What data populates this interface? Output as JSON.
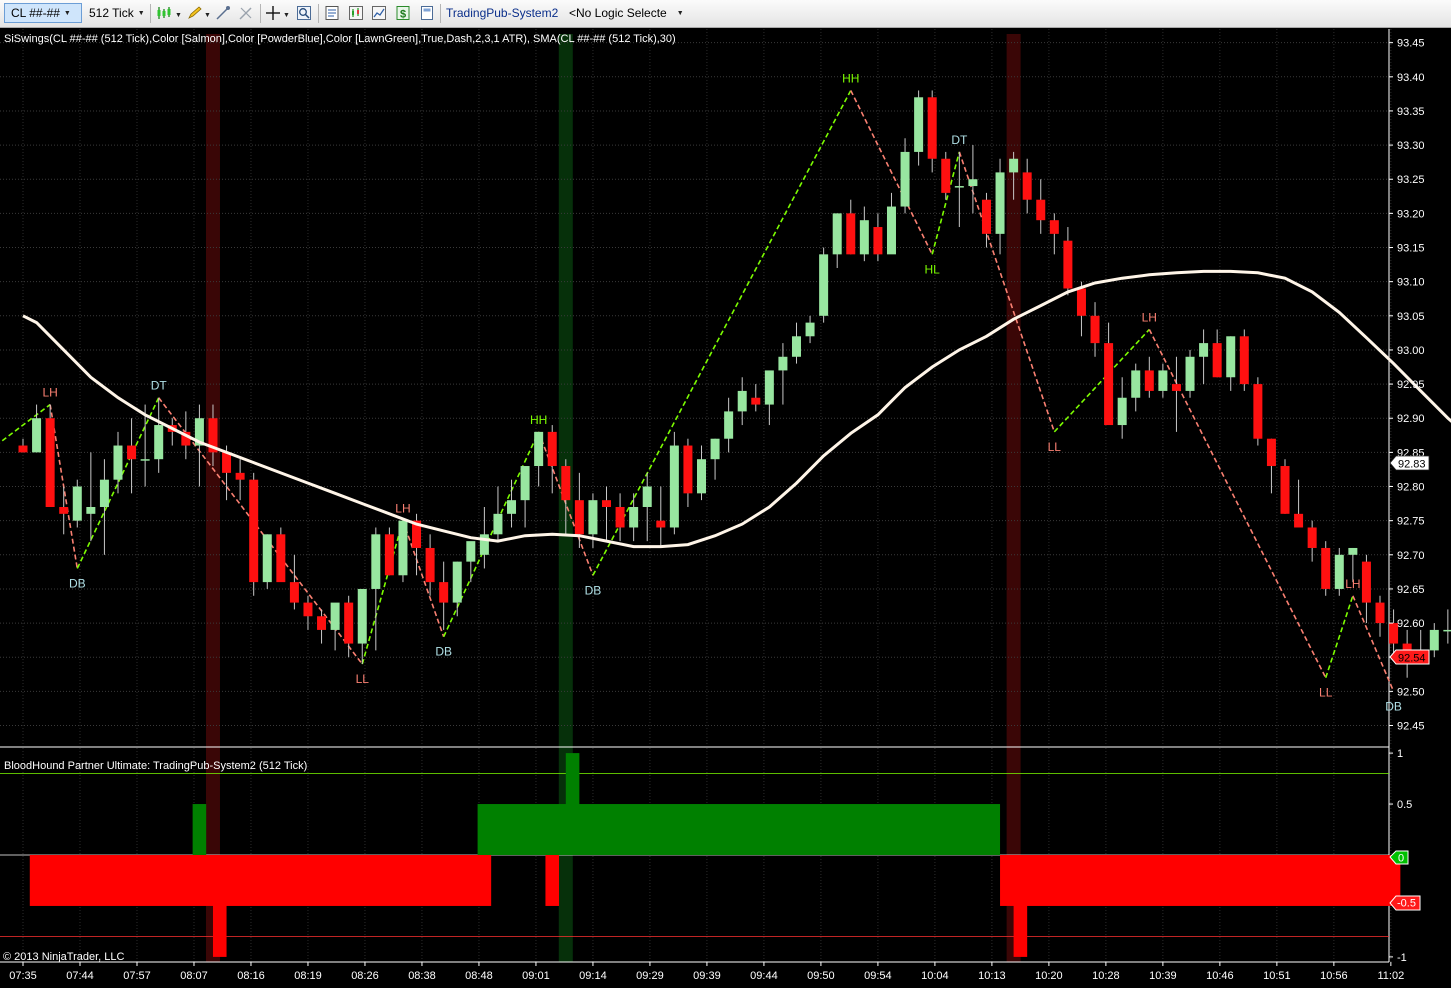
{
  "toolbar": {
    "instrument": "CL ##-##",
    "interval": "512 Tick",
    "strategy": "TradingPub-System2",
    "logic": "<No Logic Selecte",
    "icons": [
      "bar-chart-icon",
      "pencil-icon",
      "draw-tool-icon",
      "crosshair-icon",
      "zoom-icon",
      "properties-icon",
      "strategy-icon",
      "data-box-icon",
      "dollar-icon",
      "templates-icon"
    ]
  },
  "colors": {
    "up": "#98e6a0",
    "down": "#ff1010",
    "sma": "#fff5e8",
    "swing_up": "#7cfc00",
    "swing_down": "#fa8072",
    "label_high": "#fa8072",
    "label_hh": "#7cfc00",
    "label_low": "#b0e0e6",
    "bg_short": "#3a0606",
    "bg_long": "#06300a"
  },
  "price_panel": {
    "indicator_label": "SiSwings(CL ##-## (512 Tick),Color [Salmon],Color [PowderBlue],Color [LawnGreen],True,Dash,2,3,1 ATR), SMA(CL ##-## (512 Tick),30)",
    "last_price": "92.83",
    "current_price": "92.54"
  },
  "indicator_panel": {
    "label": "BloodHound Partner Ultimate: TradingPub-System2 (512 Tick)",
    "zero_marker": "0",
    "neg_marker": "-0.5",
    "copyright": "© 2013 NinjaTrader, LLC"
  },
  "chart_data": {
    "type": "candlestick",
    "price_ylim": [
      92.42,
      93.47
    ],
    "price_ticks": [
      "93.45",
      "93.40",
      "93.35",
      "93.30",
      "93.25",
      "93.20",
      "93.15",
      "93.10",
      "93.05",
      "93.00",
      "92.95",
      "92.90",
      "92.85",
      "92.80",
      "92.75",
      "92.70",
      "92.65",
      "92.60",
      "92.55",
      "92.50",
      "92.45"
    ],
    "indicator_ylim": [
      -1.05,
      1.05
    ],
    "indicator_ticks": [
      "1",
      "0.5",
      "-1"
    ],
    "x_ticks": [
      "07:35",
      "07:44",
      "07:57",
      "08:07",
      "08:16",
      "08:19",
      "08:26",
      "08:38",
      "08:48",
      "09:01",
      "09:14",
      "09:29",
      "09:39",
      "09:44",
      "09:50",
      "09:54",
      "10:04",
      "10:13",
      "10:20",
      "10:28",
      "10:39",
      "10:46",
      "10:51",
      "10:56",
      "11:02"
    ],
    "candles": [
      [
        92.86,
        92.87,
        92.85,
        92.85
      ],
      [
        92.85,
        92.92,
        92.85,
        92.9
      ],
      [
        92.9,
        92.92,
        92.77,
        92.77
      ],
      [
        92.77,
        92.8,
        92.73,
        92.76
      ],
      [
        92.75,
        92.81,
        92.74,
        92.8
      ],
      [
        92.76,
        92.85,
        92.72,
        92.77
      ],
      [
        92.77,
        92.84,
        92.7,
        92.81
      ],
      [
        92.81,
        92.88,
        92.79,
        92.86
      ],
      [
        92.86,
        92.9,
        92.79,
        92.84
      ],
      [
        92.84,
        92.92,
        92.8,
        92.84
      ],
      [
        92.84,
        92.93,
        92.82,
        92.89
      ],
      [
        92.89,
        92.9,
        92.86,
        92.88
      ],
      [
        92.88,
        92.91,
        92.84,
        92.86
      ],
      [
        92.86,
        92.92,
        92.8,
        92.9
      ],
      [
        92.9,
        92.92,
        92.83,
        92.85
      ],
      [
        92.85,
        92.86,
        92.78,
        92.82
      ],
      [
        92.82,
        92.84,
        92.78,
        92.81
      ],
      [
        92.81,
        92.82,
        92.64,
        92.66
      ],
      [
        92.66,
        92.73,
        92.65,
        92.73
      ],
      [
        92.73,
        92.74,
        92.68,
        92.66
      ],
      [
        92.66,
        92.7,
        92.62,
        92.63
      ],
      [
        92.63,
        92.64,
        92.59,
        92.61
      ],
      [
        92.61,
        92.62,
        92.57,
        92.59
      ],
      [
        92.59,
        92.62,
        92.56,
        92.63
      ],
      [
        92.63,
        92.64,
        92.55,
        92.57
      ],
      [
        92.57,
        92.61,
        92.54,
        92.65
      ],
      [
        92.65,
        92.74,
        92.56,
        92.73
      ],
      [
        92.73,
        92.74,
        92.67,
        92.67
      ],
      [
        92.67,
        92.75,
        92.66,
        92.75
      ],
      [
        92.75,
        92.76,
        92.67,
        92.71
      ],
      [
        92.71,
        92.73,
        92.64,
        92.66
      ],
      [
        92.66,
        92.69,
        92.59,
        92.63
      ],
      [
        92.63,
        92.69,
        92.61,
        92.69
      ],
      [
        92.69,
        92.7,
        92.66,
        92.72
      ],
      [
        92.7,
        92.77,
        92.68,
        92.73
      ],
      [
        92.73,
        92.8,
        92.72,
        92.76
      ],
      [
        92.76,
        92.81,
        92.74,
        92.78
      ],
      [
        92.78,
        92.82,
        92.74,
        92.83
      ],
      [
        92.83,
        92.88,
        92.8,
        92.88
      ],
      [
        92.88,
        92.89,
        92.79,
        92.83
      ],
      [
        92.83,
        92.84,
        92.73,
        92.78
      ],
      [
        92.78,
        92.82,
        92.71,
        92.73
      ],
      [
        92.73,
        92.79,
        92.71,
        92.78
      ],
      [
        92.78,
        92.8,
        92.72,
        92.77
      ],
      [
        92.77,
        92.79,
        92.72,
        92.74
      ],
      [
        92.74,
        92.79,
        92.72,
        92.77
      ],
      [
        92.77,
        92.82,
        92.72,
        92.8
      ],
      [
        92.75,
        92.8,
        92.71,
        92.74
      ],
      [
        92.74,
        92.88,
        92.73,
        92.86
      ],
      [
        92.86,
        92.87,
        92.77,
        92.79
      ],
      [
        92.79,
        92.86,
        92.78,
        92.84
      ],
      [
        92.84,
        92.87,
        92.81,
        92.87
      ],
      [
        92.87,
        92.93,
        92.85,
        92.91
      ],
      [
        92.91,
        92.96,
        92.89,
        92.94
      ],
      [
        92.93,
        92.95,
        92.91,
        92.92
      ],
      [
        92.92,
        92.96,
        92.89,
        92.97
      ],
      [
        92.97,
        93.01,
        92.92,
        92.99
      ],
      [
        92.99,
        93.04,
        92.98,
        93.02
      ],
      [
        93.02,
        93.05,
        93.01,
        93.04
      ],
      [
        93.05,
        93.15,
        93.04,
        93.14
      ],
      [
        93.14,
        93.2,
        93.12,
        93.2
      ],
      [
        93.2,
        93.22,
        93.14,
        93.14
      ],
      [
        93.14,
        93.21,
        93.13,
        93.19
      ],
      [
        93.18,
        93.2,
        93.13,
        93.14
      ],
      [
        93.14,
        93.23,
        93.16,
        93.21
      ],
      [
        93.21,
        93.31,
        93.2,
        93.29
      ],
      [
        93.29,
        93.38,
        93.27,
        93.37
      ],
      [
        93.37,
        93.38,
        93.26,
        93.28
      ],
      [
        93.28,
        93.29,
        93.22,
        93.23
      ],
      [
        93.24,
        93.29,
        93.18,
        93.24
      ],
      [
        93.24,
        93.3,
        93.2,
        93.25
      ],
      [
        93.22,
        93.23,
        93.15,
        93.17
      ],
      [
        93.17,
        93.28,
        93.14,
        93.26
      ],
      [
        93.26,
        93.29,
        93.22,
        93.28
      ],
      [
        93.26,
        93.28,
        93.2,
        93.22
      ],
      [
        93.22,
        93.25,
        93.17,
        93.19
      ],
      [
        93.19,
        93.2,
        93.14,
        93.17
      ],
      [
        93.16,
        93.18,
        93.08,
        93.09
      ],
      [
        93.09,
        93.1,
        93.02,
        93.05
      ],
      [
        93.05,
        93.07,
        92.99,
        93.01
      ],
      [
        93.01,
        93.04,
        92.92,
        92.89
      ],
      [
        92.89,
        92.96,
        92.87,
        92.93
      ],
      [
        92.93,
        92.98,
        92.91,
        92.97
      ],
      [
        92.97,
        92.99,
        92.93,
        92.94
      ],
      [
        92.94,
        92.98,
        92.93,
        92.97
      ],
      [
        92.95,
        92.99,
        92.88,
        92.94
      ],
      [
        92.94,
        93.0,
        92.93,
        92.99
      ],
      [
        92.99,
        93.03,
        92.95,
        93.01
      ],
      [
        93.01,
        93.03,
        92.96,
        92.96
      ],
      [
        92.96,
        93.02,
        92.94,
        93.02
      ],
      [
        93.02,
        93.03,
        92.94,
        92.95
      ],
      [
        92.95,
        92.96,
        92.86,
        92.87
      ],
      [
        92.87,
        92.87,
        92.79,
        92.83
      ],
      [
        92.83,
        92.84,
        92.76,
        92.76
      ],
      [
        92.76,
        92.81,
        92.75,
        92.74
      ],
      [
        92.74,
        92.75,
        92.69,
        92.71
      ],
      [
        92.71,
        92.72,
        92.64,
        92.65
      ],
      [
        92.65,
        92.71,
        92.64,
        92.7
      ],
      [
        92.7,
        92.71,
        92.66,
        92.71
      ],
      [
        92.69,
        92.7,
        92.6,
        92.63
      ],
      [
        92.63,
        92.64,
        92.58,
        92.6
      ],
      [
        92.6,
        92.62,
        92.55,
        92.57
      ],
      [
        92.57,
        92.59,
        92.52,
        92.55
      ],
      [
        92.55,
        92.59,
        92.54,
        92.56
      ],
      [
        92.56,
        92.6,
        92.55,
        92.59
      ],
      [
        92.59,
        92.62,
        92.57,
        92.59
      ],
      [
        92.59,
        92.6,
        92.51,
        92.55
      ],
      [
        92.55,
        92.56,
        92.51,
        92.51
      ],
      [
        92.56,
        92.57,
        92.52,
        92.54
      ]
    ],
    "sma": [
      [
        0,
        93.05
      ],
      [
        1,
        93.04
      ],
      [
        3,
        93.0
      ],
      [
        5,
        92.96
      ],
      [
        7,
        92.93
      ],
      [
        9,
        92.905
      ],
      [
        11,
        92.885
      ],
      [
        13,
        92.865
      ],
      [
        15,
        92.85
      ],
      [
        17,
        92.835
      ],
      [
        19,
        92.82
      ],
      [
        21,
        92.805
      ],
      [
        23,
        92.79
      ],
      [
        25,
        92.775
      ],
      [
        27,
        92.76
      ],
      [
        29,
        92.745
      ],
      [
        31,
        92.735
      ],
      [
        33,
        92.725
      ],
      [
        35,
        92.72
      ],
      [
        37,
        92.728
      ],
      [
        39,
        92.73
      ],
      [
        41,
        92.728
      ],
      [
        43,
        92.72
      ],
      [
        45,
        92.712
      ],
      [
        47,
        92.712
      ],
      [
        49,
        92.715
      ],
      [
        51,
        92.728
      ],
      [
        53,
        92.745
      ],
      [
        55,
        92.77
      ],
      [
        57,
        92.805
      ],
      [
        59,
        92.845
      ],
      [
        61,
        92.878
      ],
      [
        63,
        92.905
      ],
      [
        65,
        92.945
      ],
      [
        67,
        92.975
      ],
      [
        69,
        93.0
      ],
      [
        71,
        93.02
      ],
      [
        73,
        93.045
      ],
      [
        75,
        93.065
      ],
      [
        77,
        93.085
      ],
      [
        79,
        93.098
      ],
      [
        81,
        93.105
      ],
      [
        83,
        93.11
      ],
      [
        85,
        93.113
      ],
      [
        87,
        93.115
      ],
      [
        89,
        93.115
      ],
      [
        91,
        93.113
      ],
      [
        93,
        93.105
      ],
      [
        95,
        93.085
      ],
      [
        97,
        93.055
      ],
      [
        99,
        93.018
      ],
      [
        101,
        92.98
      ],
      [
        103,
        92.94
      ],
      [
        105,
        92.9
      ],
      [
        107,
        92.865
      ],
      [
        108,
        92.83
      ]
    ],
    "swings": [
      {
        "from": [
          -2,
          92.86
        ],
        "to": [
          2,
          92.92
        ],
        "dir": "up"
      },
      {
        "from": [
          2,
          92.92
        ],
        "to": [
          4,
          92.68
        ],
        "dir": "down"
      },
      {
        "from": [
          4,
          92.68
        ],
        "to": [
          10,
          92.93
        ],
        "dir": "up"
      },
      {
        "from": [
          10,
          92.93
        ],
        "to": [
          25,
          92.54
        ],
        "dir": "down"
      },
      {
        "from": [
          25,
          92.54
        ],
        "to": [
          28,
          92.75
        ],
        "dir": "up"
      },
      {
        "from": [
          28,
          92.75
        ],
        "to": [
          31,
          92.58
        ],
        "dir": "down"
      },
      {
        "from": [
          31,
          92.58
        ],
        "to": [
          38,
          92.88
        ],
        "dir": "up"
      },
      {
        "from": [
          38,
          92.88
        ],
        "to": [
          42,
          92.67
        ],
        "dir": "down"
      },
      {
        "from": [
          42,
          92.67
        ],
        "to": [
          61,
          93.38
        ],
        "dir": "up"
      },
      {
        "from": [
          61,
          93.38
        ],
        "to": [
          67,
          93.14
        ],
        "dir": "down"
      },
      {
        "from": [
          67,
          93.14
        ],
        "to": [
          69,
          93.29
        ],
        "dir": "up"
      },
      {
        "from": [
          69,
          93.29
        ],
        "to": [
          76,
          92.88
        ],
        "dir": "down"
      },
      {
        "from": [
          76,
          92.88
        ],
        "to": [
          83,
          93.03
        ],
        "dir": "up"
      },
      {
        "from": [
          83,
          93.03
        ],
        "to": [
          96,
          92.52
        ],
        "dir": "down"
      },
      {
        "from": [
          96,
          92.52
        ],
        "to": [
          98,
          92.64
        ],
        "dir": "up"
      },
      {
        "from": [
          98,
          92.64
        ],
        "to": [
          101,
          92.5
        ],
        "dir": "down"
      }
    ],
    "swing_labels": [
      {
        "bar": 2,
        "price": 92.92,
        "text": "LH",
        "pos": "above",
        "kind": "high"
      },
      {
        "bar": 4,
        "price": 92.68,
        "text": "DB",
        "pos": "below",
        "kind": "low"
      },
      {
        "bar": 10,
        "price": 92.93,
        "text": "DT",
        "pos": "above",
        "kind": "low"
      },
      {
        "bar": 25,
        "price": 92.54,
        "text": "LL",
        "pos": "below",
        "kind": "high"
      },
      {
        "bar": 28,
        "price": 92.75,
        "text": "LH",
        "pos": "above",
        "kind": "high"
      },
      {
        "bar": 31,
        "price": 92.58,
        "text": "DB",
        "pos": "below",
        "kind": "low"
      },
      {
        "bar": 38,
        "price": 92.88,
        "text": "HH",
        "pos": "above",
        "kind": "hh"
      },
      {
        "bar": 42,
        "price": 92.67,
        "text": "DB",
        "pos": "below",
        "kind": "low"
      },
      {
        "bar": 61,
        "price": 93.38,
        "text": "HH",
        "pos": "above",
        "kind": "hh"
      },
      {
        "bar": 67,
        "price": 93.14,
        "text": "HL",
        "pos": "below",
        "kind": "hh"
      },
      {
        "bar": 69,
        "price": 93.29,
        "text": "DT",
        "pos": "above",
        "kind": "low"
      },
      {
        "bar": 76,
        "price": 92.88,
        "text": "LL",
        "pos": "below",
        "kind": "high"
      },
      {
        "bar": 83,
        "price": 93.03,
        "text": "LH",
        "pos": "above",
        "kind": "high"
      },
      {
        "bar": 96,
        "price": 92.52,
        "text": "LL",
        "pos": "below",
        "kind": "high"
      },
      {
        "bar": 98,
        "price": 92.64,
        "text": "LH",
        "pos": "above",
        "kind": "high"
      },
      {
        "bar": 101,
        "price": 92.5,
        "text": "DB",
        "pos": "below",
        "kind": "low"
      }
    ],
    "signal_bars": [
      {
        "bar": 14,
        "type": "short"
      },
      {
        "bar": 40,
        "type": "long"
      },
      {
        "bar": 73,
        "type": "short"
      }
    ],
    "indicator_blocks": [
      {
        "from": 0.5,
        "to": 34.5,
        "value": -0.5,
        "color": "#ff0000"
      },
      {
        "from": 12.5,
        "to": 13.5,
        "value": 0.5,
        "color": "#008000"
      },
      {
        "from": 14.0,
        "to": 15.0,
        "value": -1.0,
        "color": "#ff0000"
      },
      {
        "from": 33.5,
        "to": 72.0,
        "value": 0.5,
        "color": "#008000"
      },
      {
        "from": 38.5,
        "to": 39.5,
        "value": -0.5,
        "color": "#ff0000"
      },
      {
        "from": 40.0,
        "to": 41.0,
        "value": 1.0,
        "color": "#008000"
      },
      {
        "from": 72.0,
        "to": 101.5,
        "value": -0.5,
        "color": "#ff0000"
      },
      {
        "from": 73.0,
        "to": 74.0,
        "value": -1.0,
        "color": "#ff0000"
      }
    ]
  }
}
